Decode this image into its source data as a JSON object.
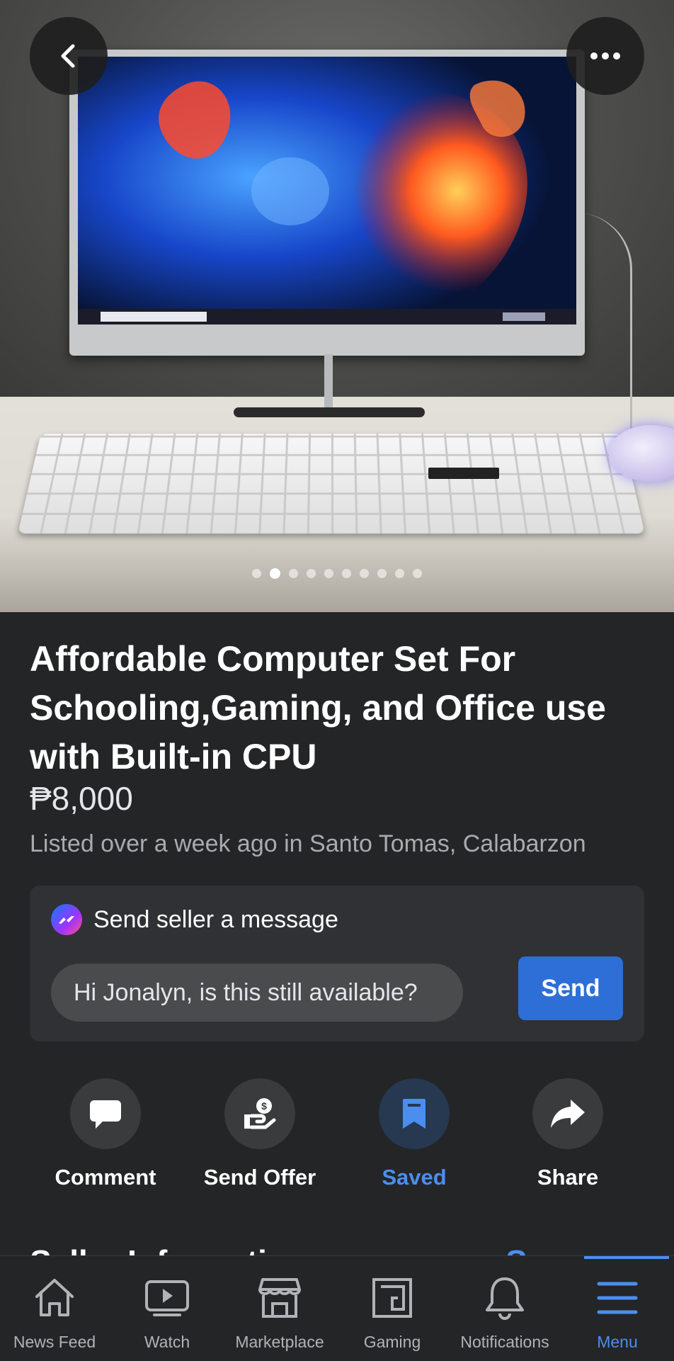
{
  "photo": {
    "image_count": 10,
    "active_index": 1
  },
  "listing": {
    "title": "Affordable Computer Set For Schooling,Gaming, and Office use with Built-in CPU",
    "price": "₱8,000",
    "meta": "Listed over a week ago in Santo Tomas, Calabarzon"
  },
  "message": {
    "heading": "Send seller a message",
    "input_value": "Hi Jonalyn, is this still available?",
    "send_label": "Send"
  },
  "actions": {
    "comment": "Comment",
    "send_offer": "Send Offer",
    "saved": "Saved",
    "share": "Share"
  },
  "seller": {
    "heading": "Seller Information",
    "link": "See Profile"
  },
  "nav": {
    "news_feed": "News Feed",
    "watch": "Watch",
    "marketplace": "Marketplace",
    "gaming": "Gaming",
    "notifications": "Notifications",
    "menu": "Menu"
  },
  "colors": {
    "background": "#242526",
    "accent": "#4b8ef0",
    "send_button": "#2d6fd6",
    "card": "#303134"
  }
}
